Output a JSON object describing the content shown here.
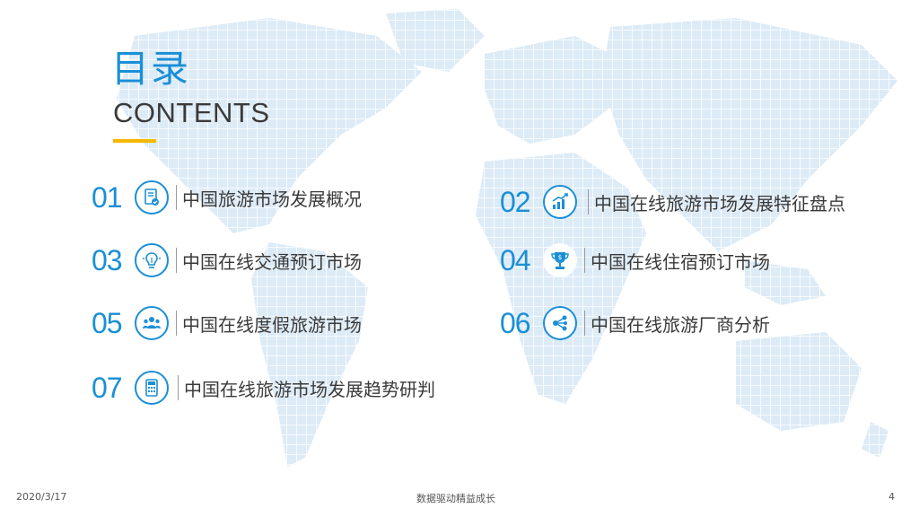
{
  "header": {
    "title_cn": "目录",
    "title_en": "CONTENTS"
  },
  "items": [
    {
      "num": "01",
      "label": "中国旅游市场发展概况",
      "icon": "document-check-icon"
    },
    {
      "num": "02",
      "label": "中国在线旅游市场发展特征盘点",
      "icon": "bar-chart-icon"
    },
    {
      "num": "03",
      "label": "中国在线交通预订市场",
      "icon": "lightbulb-icon"
    },
    {
      "num": "04",
      "label": "中国在线住宿预订市场",
      "icon": "trophy-icon"
    },
    {
      "num": "05",
      "label": "中国在线度假旅游市场",
      "icon": "users-icon"
    },
    {
      "num": "06",
      "label": "中国在线旅游厂商分析",
      "icon": "share-icon"
    },
    {
      "num": "07",
      "label": "中国在线旅游市场发展趋势研判",
      "icon": "calculator-icon"
    }
  ],
  "footer": {
    "date": "2020/3/17",
    "slogan": "数据驱动精益成长",
    "page": "4"
  },
  "colors": {
    "accent": "#1a8fd6",
    "underline": "#f5b800",
    "map": "#cfe3f3"
  }
}
